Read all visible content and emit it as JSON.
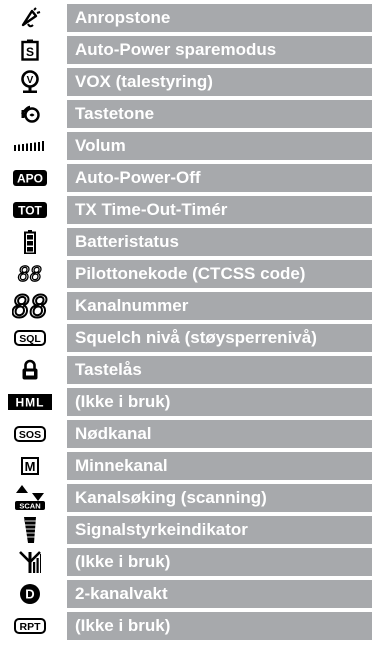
{
  "rows": [
    {
      "icon": "bell-ringing-icon",
      "label": "Anropstone"
    },
    {
      "icon": "power-save-s-icon",
      "label": "Auto-Power sparemodus"
    },
    {
      "icon": "vox-microphone-icon",
      "label": "VOX (talestyring)"
    },
    {
      "icon": "key-tone-speaker-icon",
      "label": "Tastetone"
    },
    {
      "icon": "volume-bars-icon",
      "label": "Volum"
    },
    {
      "icon": "apo-badge-icon",
      "label": "Auto-Power-Off",
      "icon_text": "APO"
    },
    {
      "icon": "tot-badge-icon",
      "label": "TX Time-Out-Timér",
      "icon_text": "TOT"
    },
    {
      "icon": "battery-icon",
      "label": "Batteristatus"
    },
    {
      "icon": "small-lcd-digits-icon",
      "label": "Pilottonekode (CTCSS code)",
      "icon_text": "88"
    },
    {
      "icon": "large-lcd-digits-icon",
      "label": "Kanalnummer",
      "icon_text": "88"
    },
    {
      "icon": "sql-badge-icon",
      "label": "Squelch nivå (støysperrenivå)",
      "icon_text": "SQL"
    },
    {
      "icon": "lock-icon",
      "label": "Tastelås"
    },
    {
      "icon": "hml-power-icon",
      "label": "(Ikke i bruk)",
      "icon_text": "HML"
    },
    {
      "icon": "sos-badge-icon",
      "label": "Nødkanal",
      "icon_text": "SOS"
    },
    {
      "icon": "memory-m-icon",
      "label": "Minnekanal",
      "icon_text": "M"
    },
    {
      "icon": "scan-arrows-icon",
      "label": "Kanalsøking (scanning)",
      "icon_text": "SCAN"
    },
    {
      "icon": "signal-strength-icon",
      "label": "Signalstyrkeindikator"
    },
    {
      "icon": "antenna-icon",
      "label": "(Ikke i bruk)"
    },
    {
      "icon": "dual-watch-d-icon",
      "label": "2-kanalvakt",
      "icon_text": "D"
    },
    {
      "icon": "rpt-badge-icon",
      "label": "(Ikke i bruk)",
      "icon_text": "RPT"
    }
  ]
}
